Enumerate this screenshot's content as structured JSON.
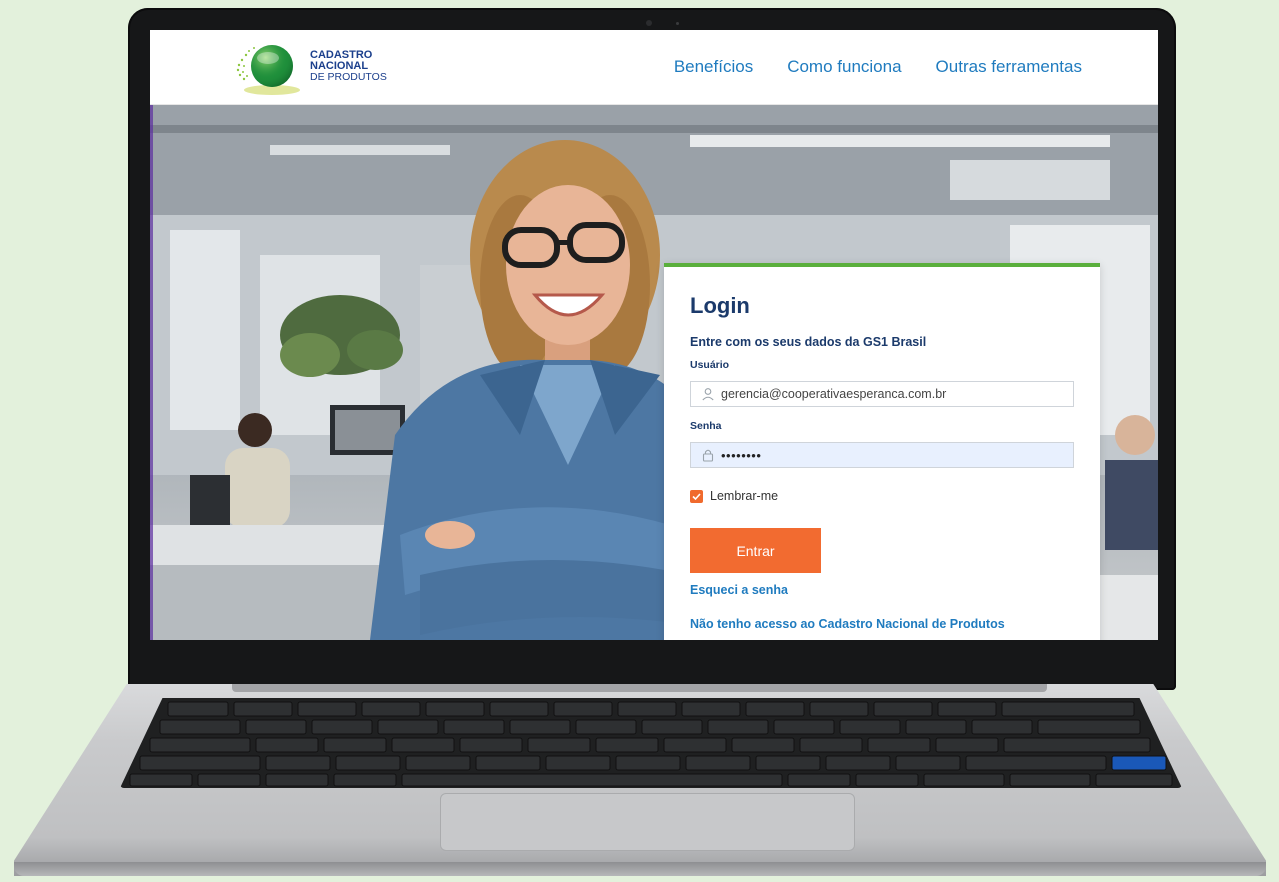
{
  "header": {
    "logo": {
      "line1": "CADASTRO",
      "line2": "NACIONAL",
      "line3": "DE PRODUTOS"
    },
    "nav": [
      {
        "label": "Benefícios"
      },
      {
        "label": "Como funciona"
      },
      {
        "label": "Outras ferramentas"
      }
    ]
  },
  "login": {
    "title": "Login",
    "subtitle": "Entre com os seus dados da GS1 Brasil",
    "username_label": "Usuário",
    "username_value": "gerencia@cooperativaesperanca.com.br",
    "password_label": "Senha",
    "password_value": "••••••••",
    "remember_label": "Lembrar-me",
    "remember_checked": true,
    "submit_label": "Entrar",
    "forgot_link": "Esqueci a senha",
    "no_access_link": "Não tenho acesso ao Cadastro Nacional de Produtos"
  },
  "colors": {
    "accent_orange": "#f26b30",
    "card_top_border": "#5aaf3c",
    "link_blue": "#1f7bbf",
    "heading_navy": "#1b3a6b",
    "background": "#e3f1dc"
  },
  "icons": {
    "user": "user-icon",
    "lock": "lock-icon",
    "check": "check-icon"
  }
}
